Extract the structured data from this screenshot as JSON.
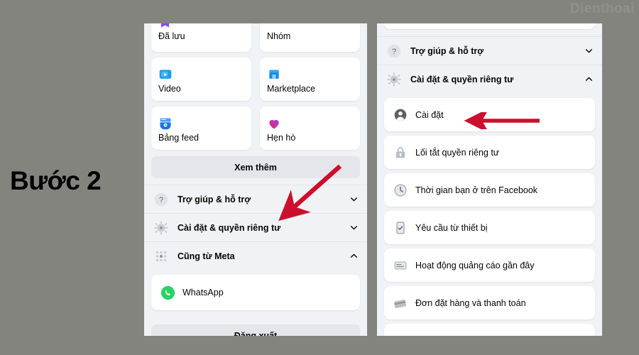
{
  "canvas": {
    "background": "#84847f",
    "watermark": "Dienthoai"
  },
  "annotation": {
    "step_caption": "Bước 2",
    "arrow_color": "#cc0f2c",
    "arrows": [
      {
        "name": "arrow-to-settings-privacy-left",
        "direction": "down-left"
      },
      {
        "name": "arrow-to-settings-right",
        "direction": "left"
      }
    ]
  },
  "left_panel": {
    "name": "facebook-menu-screen",
    "tiles": [
      {
        "label": "Đã lưu",
        "icon": "bookmark-icon",
        "clipped": true
      },
      {
        "label": "Nhóm",
        "icon": "groups-icon",
        "clipped": true
      },
      {
        "label": "Video",
        "icon": "video-icon",
        "clipped": false
      },
      {
        "label": "Marketplace",
        "icon": "marketplace-icon",
        "clipped": false
      },
      {
        "label": "Bảng feed",
        "icon": "feeds-icon",
        "clipped": false
      },
      {
        "label": "Hẹn hò",
        "icon": "dating-heart-icon",
        "clipped": false
      }
    ],
    "see_more_label": "Xem thêm",
    "accordions": [
      {
        "label": "Trợ giúp & hỗ trợ",
        "icon": "help-question-icon",
        "chevron": "chevron-down",
        "expanded": false
      },
      {
        "label": "Cài đặt & quyền riêng tư",
        "icon": "gear-icon",
        "chevron": "chevron-down",
        "expanded": false
      },
      {
        "label": "Cũng từ Meta",
        "icon": "meta-apps-grid-icon",
        "chevron": "chevron-up",
        "expanded": true
      }
    ],
    "meta_apps": [
      {
        "label": "WhatsApp",
        "icon": "whatsapp-icon"
      }
    ],
    "logout_label": "Đăng xuất"
  },
  "right_panel": {
    "name": "facebook-settings-privacy-expanded-screen",
    "accordions": [
      {
        "label": "Trợ giúp & hỗ trợ",
        "icon": "help-question-icon",
        "chevron": "chevron-down",
        "expanded": false
      },
      {
        "label": "Cài đặt & quyền riêng tư",
        "icon": "gear-icon",
        "chevron": "chevron-up",
        "expanded": true
      }
    ],
    "items": [
      {
        "label": "Cài đặt",
        "icon": "account-avatar-icon"
      },
      {
        "label": "Lối tắt quyền riêng tư",
        "icon": "privacy-lock-icon"
      },
      {
        "label": "Thời gian bạn ở trên Facebook",
        "icon": "clock-icon"
      },
      {
        "label": "Yêu cầu từ thiết bị",
        "icon": "device-request-icon"
      },
      {
        "label": "Hoạt động quảng cáo gần đây",
        "icon": "ad-activity-icon"
      },
      {
        "label": "Đơn đặt hàng và thanh toán",
        "icon": "orders-payments-icon"
      }
    ]
  },
  "colors": {
    "panel_bg": "#f0f2f5",
    "card_bg": "#ffffff",
    "text": "#050505",
    "grey_button": "#e4e6eb",
    "divider": "#e2e4e8"
  }
}
